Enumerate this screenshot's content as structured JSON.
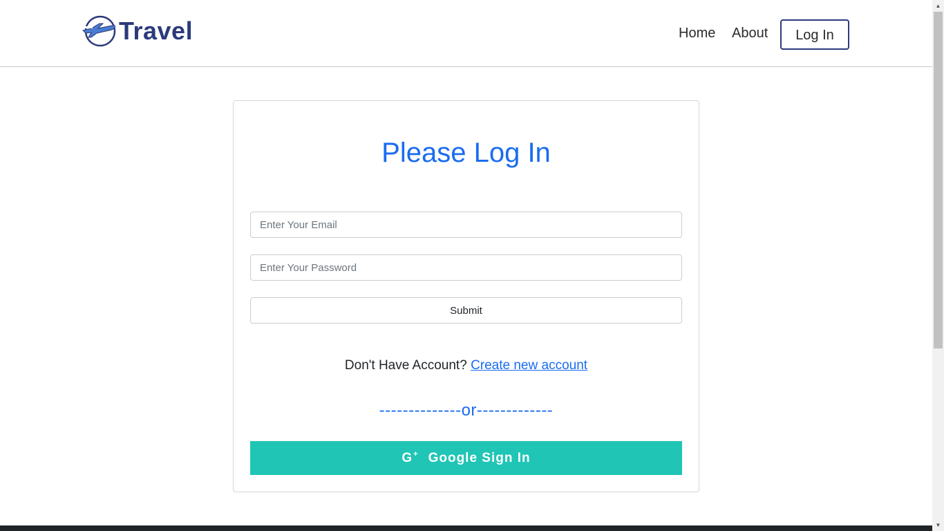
{
  "brand": {
    "name": "Travel",
    "color": "#2c3a7c"
  },
  "nav": {
    "home": "Home",
    "about": "About",
    "login": "Log In"
  },
  "card": {
    "title": "Please Log In",
    "email_placeholder": "Enter Your Email",
    "password_placeholder": "Enter Your Password",
    "submit": "Submit",
    "account_question": "Don't Have Account?",
    "create_account": "Create new account",
    "divider": "--------------or-------------",
    "google_icon_letter": "G",
    "google_icon_plus": "+",
    "google_sign_in": "Google Sign In"
  },
  "colors": {
    "accent": "#1a6cf0",
    "google_button": "#20c5b5",
    "footer": "#1f2428"
  },
  "icons": {
    "logo": "airplane-globe-icon",
    "google": "google-plus-icon",
    "scroll_up": "arrow-up-icon",
    "scroll_down": "arrow-down-icon"
  }
}
